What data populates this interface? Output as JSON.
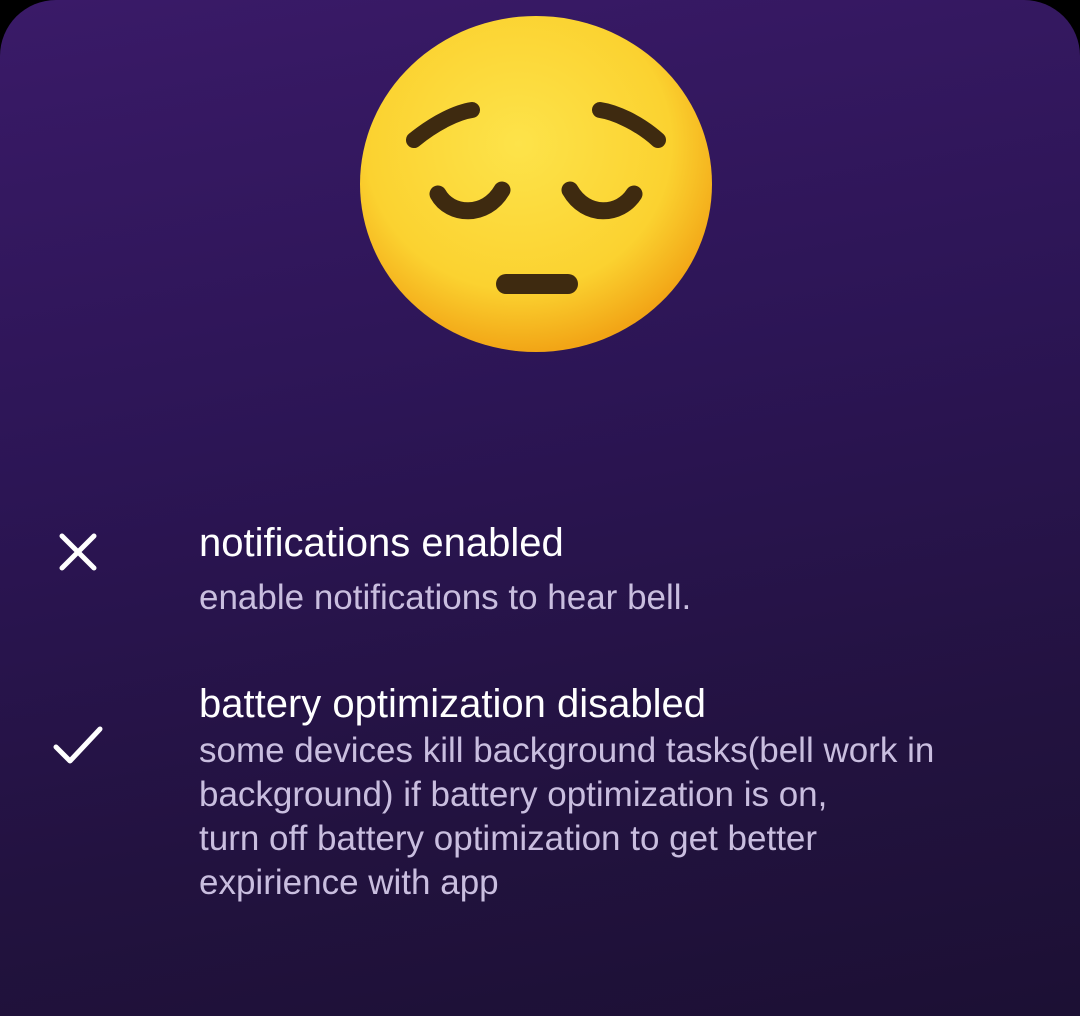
{
  "dialog": {
    "emoji_icon": "pensive-face-icon",
    "items": [
      {
        "status_icon": "close-icon",
        "title": "notifications enabled",
        "description": "enable notifications to hear bell."
      },
      {
        "status_icon": "check-icon",
        "title": "battery optimization disabled",
        "description": "some devices kill background tasks(bell work in\nbackground) if battery optimization is on,\nturn off battery optimization to get better\nexpirience with app"
      }
    ]
  },
  "colors": {
    "background_top": "#3a1a68",
    "background_bottom": "#1c1034",
    "title_text": "#ffffff",
    "description_text": "#c9bedf",
    "emoji_face": "#fbd835"
  }
}
